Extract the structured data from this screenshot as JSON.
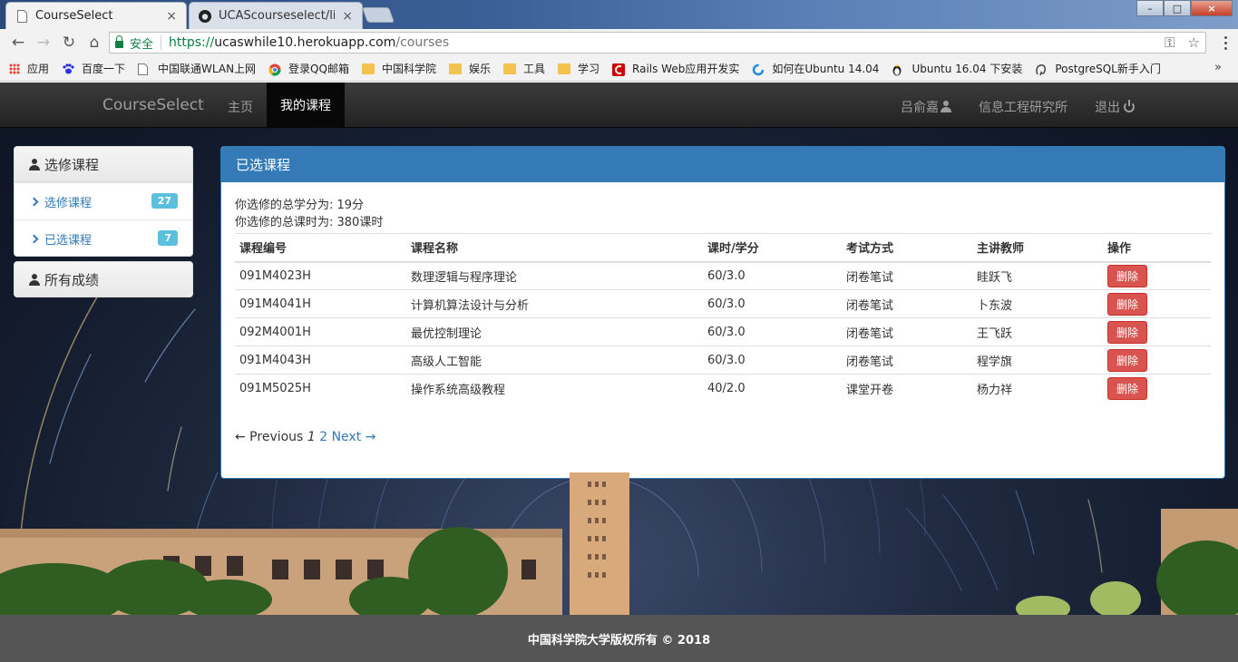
{
  "browser": {
    "tabs": [
      {
        "title": "CourseSelect",
        "close": "×"
      },
      {
        "title": "UCAScourseselect/lib a",
        "close": "×"
      }
    ],
    "window_buttons": {
      "minimize": "–",
      "maximize": "□",
      "close": "×"
    },
    "toolbar": {
      "back": "←",
      "forward": "→",
      "reload": "↻",
      "home": "⌂",
      "secure_label": "安全",
      "url_scheme": "https://",
      "url_host": "ucaswhile10.herokuapp.com",
      "url_path": "/courses",
      "key_icon": "⚿",
      "star_icon": "☆"
    },
    "bookmarks": [
      {
        "label": "应用",
        "icon": "apps-icon"
      },
      {
        "label": "百度一下",
        "icon": "baidu-icon"
      },
      {
        "label": "中国联通WLAN上网",
        "icon": "page-icon"
      },
      {
        "label": "登录QQ邮箱",
        "icon": "chrome-icon"
      },
      {
        "label": "中国科学院",
        "icon": "folder-icon"
      },
      {
        "label": "娱乐",
        "icon": "folder-icon"
      },
      {
        "label": "工具",
        "icon": "folder-icon"
      },
      {
        "label": "学习",
        "icon": "folder-icon"
      },
      {
        "label": "Rails Web应用开发实",
        "icon": "rails-icon"
      },
      {
        "label": "如何在Ubuntu 14.04",
        "icon": "spinner-icon"
      },
      {
        "label": "Ubuntu 16.04 下安装",
        "icon": "tux-icon"
      },
      {
        "label": "PostgreSQL新手入门",
        "icon": "postgres-icon"
      }
    ],
    "bookmarks_overflow": "»"
  },
  "navbar": {
    "brand": "CourseSelect",
    "home": "主页",
    "my_courses": "我的课程",
    "user": "吕俞嘉",
    "institute": "信息工程研究所",
    "logout": "退出"
  },
  "sidebar": {
    "elective_head": "选修课程",
    "items": [
      {
        "label": "选修课程",
        "count": "27"
      },
      {
        "label": "已选课程",
        "count": "7"
      }
    ],
    "grades_head": "所有成绩"
  },
  "main": {
    "title": "已选课程",
    "total_credits": "你选修的总学分为: 19分",
    "total_hours": "你选修的总课时为: 380课时",
    "columns": [
      "课程编号",
      "课程名称",
      "课时/学分",
      "考试方式",
      "主讲教师",
      "操作"
    ],
    "rows": [
      {
        "code": "091M4023H",
        "name": "数理逻辑与程序理论",
        "hours": "60/3.0",
        "exam": "闭卷笔试",
        "teacher": "眭跃飞",
        "action": "删除"
      },
      {
        "code": "091M4041H",
        "name": "计算机算法设计与分析",
        "hours": "60/3.0",
        "exam": "闭卷笔试",
        "teacher": "卜东波",
        "action": "删除"
      },
      {
        "code": "092M4001H",
        "name": "最优控制理论",
        "hours": "60/3.0",
        "exam": "闭卷笔试",
        "teacher": "王飞跃",
        "action": "删除"
      },
      {
        "code": "091M4043H",
        "name": "高级人工智能",
        "hours": "60/3.0",
        "exam": "闭卷笔试",
        "teacher": "程学旗",
        "action": "删除"
      },
      {
        "code": "091M5025H",
        "name": "操作系统高级教程",
        "hours": "40/2.0",
        "exam": "课堂开卷",
        "teacher": "杨力祥",
        "action": "删除"
      }
    ],
    "pager": {
      "previous": "← Previous",
      "current": "1",
      "page2": "2",
      "next": "Next →"
    }
  },
  "footer": {
    "text": "中国科学院大学版权所有 © 2018"
  },
  "colors": {
    "primary": "#337ab7",
    "danger": "#d9534f",
    "info_badge": "#5bc0de",
    "navbar": "#222222",
    "footer": "#555555"
  }
}
